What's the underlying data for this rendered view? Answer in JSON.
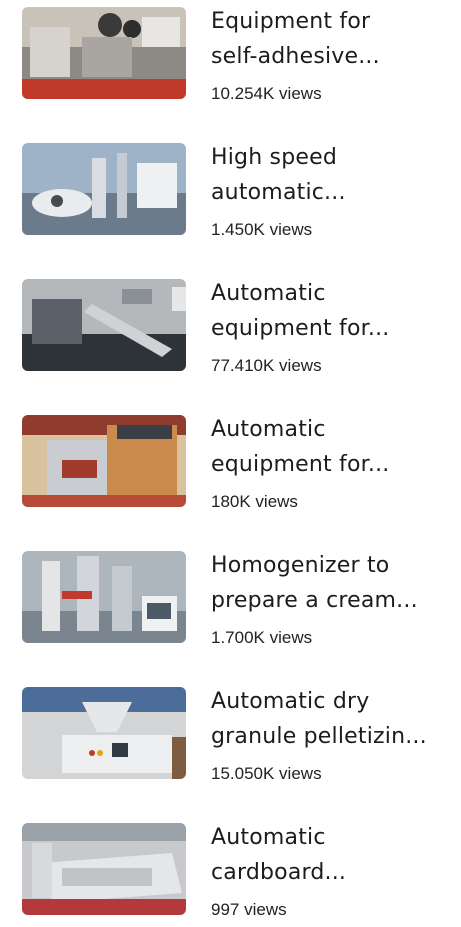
{
  "videos": [
    {
      "title_line1": "Equipment for",
      "title_line2": "self-adhesive...",
      "views": "10.254K views",
      "thumb_colors": [
        "#c9c2b8",
        "#8d8a86",
        "#c0392b"
      ]
    },
    {
      "title_line1": "High speed",
      "title_line2": "automatic...",
      "views": "1.450K views",
      "thumb_colors": [
        "#9fb3c8",
        "#d9dde2",
        "#6b7b8c"
      ]
    },
    {
      "title_line1": "Automatic",
      "title_line2": "equipment for...",
      "views": "77.410K views",
      "thumb_colors": [
        "#b5b8bb",
        "#5b6168",
        "#2e3338"
      ]
    },
    {
      "title_line1": "Automatic",
      "title_line2": "equipment for...",
      "views": "180K views",
      "thumb_colors": [
        "#c98a4b",
        "#8f3b2d",
        "#d8c2a0"
      ]
    },
    {
      "title_line1": "Homogenizer to",
      "title_line2": "prepare a cream...",
      "views": "1.700K views",
      "thumb_colors": [
        "#aeb6bd",
        "#e3e5e7",
        "#7b858f"
      ]
    },
    {
      "title_line1": "Automatic dry",
      "title_line2": "granule pelletizin...",
      "views": "15.050K views",
      "thumb_colors": [
        "#d3d4d6",
        "#4c6d9a",
        "#7d5c3f"
      ]
    },
    {
      "title_line1": "Automatic",
      "title_line2": "cardboard...",
      "views": "997 views",
      "thumb_colors": [
        "#c7c9cc",
        "#9aa1a8",
        "#b23a3a"
      ]
    }
  ]
}
